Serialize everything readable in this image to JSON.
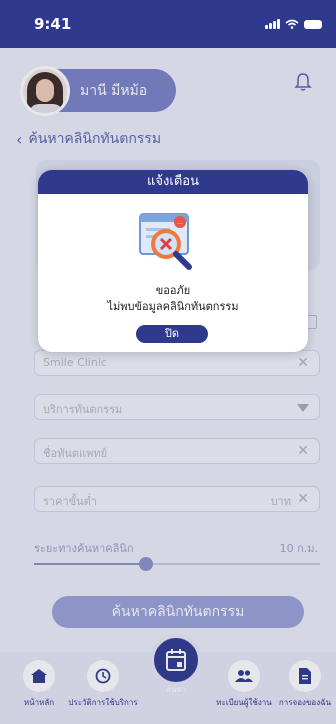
{
  "status_bar": {
    "time": "9:41"
  },
  "header": {
    "user_name": "มานี มีหม้อ"
  },
  "page": {
    "back_label": "ค้นหาคลินิกทันตกรรม"
  },
  "form": {
    "clinic_name_value": "Smile Clinic",
    "service_placeholder": "บริการทันตกรรม",
    "dentist_placeholder": "ชื่อทันตแพทย์",
    "min_price_placeholder": "ราคาขั้นต่ำ",
    "min_price_unit": "บาท",
    "range_label": "ระยะทางค้นหาคลินิก",
    "range_value": "10 ก.ม.",
    "range_fraction": 0.39,
    "search_button": "ค้นหาคลินิกทันตกรรม"
  },
  "modal": {
    "title": "แจ้งเตือน",
    "message_line1": "ขออภัย",
    "message_line2": "ไม่พบข้อมูลคลินิกทันตกรรม",
    "close_button": "ปิด"
  },
  "bottom_nav": {
    "items": [
      {
        "label": "หน้าหลัก",
        "icon": "home-icon"
      },
      {
        "label": "ประวัติการใช้บริการ",
        "icon": "history-icon"
      },
      {
        "label": "ค้นหา",
        "icon": "calendar-icon"
      },
      {
        "label": "ทะเบียนผู้ใช้งาน",
        "icon": "users-icon"
      },
      {
        "label": "การจองของฉัน",
        "icon": "document-icon"
      }
    ]
  },
  "colors": {
    "primary": "#2f3a8f",
    "accent_light": "#7b82c6"
  }
}
